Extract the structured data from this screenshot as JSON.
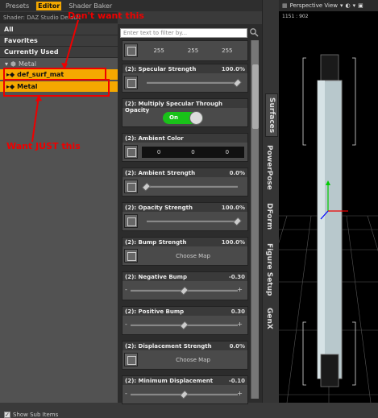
{
  "tabs": [
    {
      "label": "Presets"
    },
    {
      "label": "Editor"
    },
    {
      "label": "Shader Baker"
    }
  ],
  "shader_label": "Shader: DAZ Studio Default",
  "categories": [
    "All",
    "Favorites",
    "Currently Used"
  ],
  "tree": {
    "group": "Metal",
    "items": [
      "def_surf_mat",
      "Metal"
    ]
  },
  "annotations": {
    "top": "Don't want this",
    "bottom": "Want JUST this"
  },
  "show_sub": "Show Sub Items",
  "filter_placeholder": "Enter text to filter by...",
  "color_row": [
    "255",
    "255",
    "255"
  ],
  "props": [
    {
      "label": "(2): Specular Strength",
      "value": "100.0%",
      "kind": "slider",
      "knob": 1.0
    },
    {
      "label": "(2): Multiply Specular Through Opacity",
      "value": "",
      "kind": "toggle",
      "toggle": "On"
    },
    {
      "label": "(2): Ambient Color",
      "value": "",
      "kind": "color",
      "nums": [
        "0",
        "0",
        "0"
      ]
    },
    {
      "label": "(2): Ambient Strength",
      "value": "0.0%",
      "kind": "slider",
      "knob": 0.0
    },
    {
      "label": "(2): Opacity Strength",
      "value": "100.0%",
      "kind": "slider",
      "knob": 1.0
    },
    {
      "label": "(2): Bump Strength",
      "value": "100.0%",
      "kind": "map",
      "map": "Choose Map"
    },
    {
      "label": "(2): Negative Bump",
      "value": "-0.30",
      "kind": "bump",
      "knob": 0.5
    },
    {
      "label": "(2): Positive Bump",
      "value": "0.30",
      "kind": "bump",
      "knob": 0.5
    },
    {
      "label": "(2): Displacement Strength",
      "value": "0.0%",
      "kind": "map",
      "map": "Choose Map"
    },
    {
      "label": "(2): Minimum Displacement",
      "value": "-0.10",
      "kind": "bump",
      "knob": 0.5
    }
  ],
  "side_tabs": [
    "Surfaces",
    "PowerPose",
    "DForm",
    "Figure Setup",
    "GenX"
  ],
  "viewport": {
    "title": "Perspective View",
    "coord": "1151 : 902"
  }
}
